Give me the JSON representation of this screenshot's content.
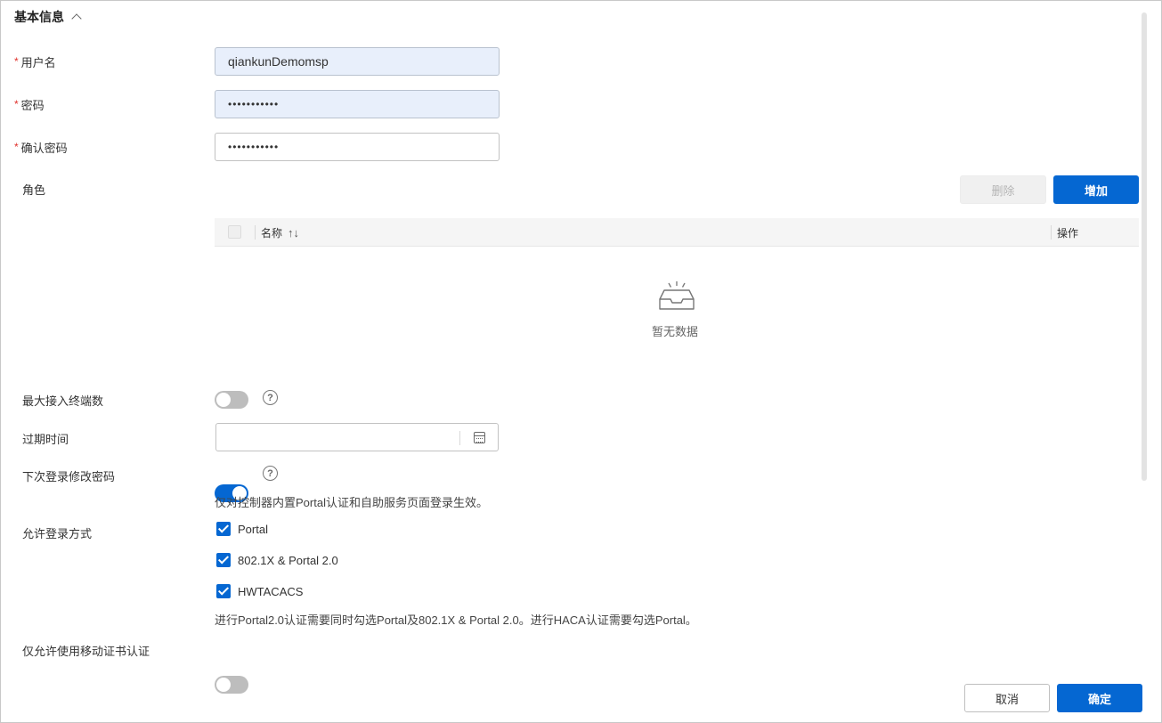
{
  "section": {
    "title": "基本信息"
  },
  "form": {
    "username": {
      "label": "用户名",
      "required_mark": "*",
      "value": "qiankunDemomsp"
    },
    "password": {
      "label": "密码",
      "required_mark": "*",
      "value": "•••••••••••"
    },
    "confirm_password": {
      "label": "确认密码",
      "required_mark": "*",
      "value": "•••••••••••"
    },
    "role": {
      "label": "角色",
      "delete_label": "删除",
      "add_label": "增加",
      "columns": {
        "name": "名称",
        "sort_glyph": "↑↓",
        "action": "操作"
      },
      "empty_text": "暂无数据"
    },
    "max_terminals": {
      "label": "最大接入终端数",
      "enabled": false,
      "help": "?"
    },
    "expire_time": {
      "label": "过期时间",
      "value": ""
    },
    "change_pwd_next_login": {
      "label": "下次登录修改密码",
      "enabled": true,
      "help": "?",
      "hint": "仅对控制器内置Portal认证和自助服务页面登录生效。"
    },
    "login_methods": {
      "label": "允许登录方式",
      "options": [
        {
          "label": "Portal",
          "checked": true
        },
        {
          "label": "802.1X & Portal 2.0",
          "checked": true
        },
        {
          "label": "HWTACACS",
          "checked": true
        }
      ],
      "hint": "进行Portal2.0认证需要同时勾选Portal及802.1X & Portal 2.0。进行HACA认证需要勾选Portal。"
    },
    "mobile_cert_only": {
      "label": "仅允许使用移动证书认证",
      "enabled": false
    }
  },
  "footer": {
    "cancel_label": "取消",
    "confirm_label": "确定"
  },
  "colors": {
    "primary": "#0567d2",
    "required": "#e0312b",
    "filled_input": "#e8effb"
  }
}
